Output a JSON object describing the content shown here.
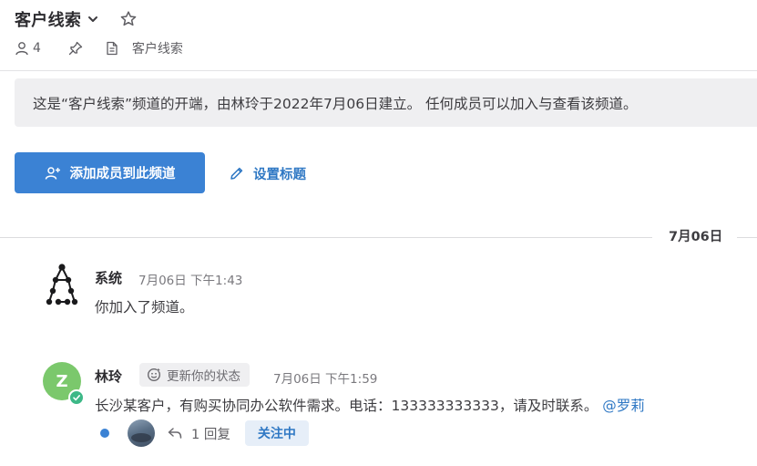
{
  "header": {
    "channel_title": "客户线索",
    "member_count": "4",
    "purpose": "客户线索"
  },
  "intro": {
    "text": "这是“客户线索”频道的开端，由林玲于2022年7月06日建立。 任何成员可以加入与查看该频道。"
  },
  "actions": {
    "add_members_label": "添加成员到此频道",
    "set_header_label": "设置标题"
  },
  "date_separator": "7月06日",
  "posts": [
    {
      "author": "系统",
      "time": "7月06日 下午1:43",
      "message": "你加入了频道。"
    },
    {
      "author": "林玲",
      "avatar_initial": "Z",
      "avatar_color": "#7bc86c",
      "status_chip": "更新你的状态",
      "time": "7月06日 下午1:59",
      "message": "长沙某客户，有购买协同办公软件需求。电话：133333333333，请及时联系。",
      "mention": "@罗莉",
      "reply_count": "1 回复",
      "follow_label": "关注中"
    }
  ],
  "icons": {
    "chevron": "chevron-down-icon",
    "star": "star-icon",
    "members": "member-icon",
    "pin": "pin-icon",
    "purpose": "document-icon",
    "add_member": "add-member-icon",
    "edit": "pencil-icon",
    "status": "smiley-icon",
    "reply": "reply-arrow-icon"
  },
  "colors": {
    "primary": "#3b82d4",
    "link": "#2f78c4",
    "online": "#3db887"
  }
}
